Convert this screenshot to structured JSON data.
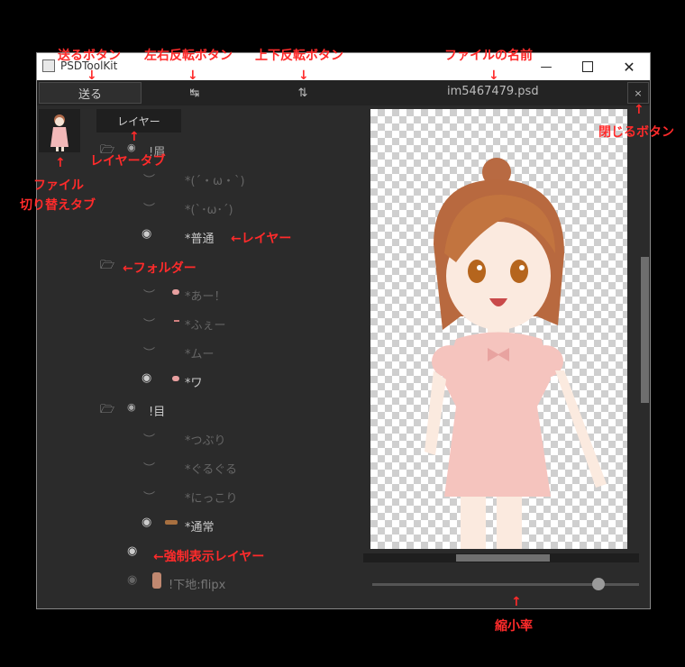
{
  "window": {
    "title": "PSDToolKit"
  },
  "toolbar": {
    "send_label": "送る",
    "flip_h_icon": "↹",
    "flip_v_icon": "⇅",
    "file_name": "im5467479.psd",
    "close_label": "×"
  },
  "panel": {
    "layer_tab": "レイヤー"
  },
  "layers": [
    {
      "name": "!眉",
      "kind": "folder"
    },
    {
      "name": "*(´・ω・`)",
      "kind": "layer"
    },
    {
      "name": "*(`･ω･´)",
      "kind": "layer"
    },
    {
      "name": "*普通",
      "kind": "layer"
    },
    {
      "name": "",
      "kind": "folder"
    },
    {
      "name": "*あー！",
      "kind": "layer"
    },
    {
      "name": "*ふぇー",
      "kind": "layer"
    },
    {
      "name": "*ムー",
      "kind": "layer"
    },
    {
      "name": "*ワ",
      "kind": "layer"
    },
    {
      "name": "!目",
      "kind": "folder"
    },
    {
      "name": "*つぶり",
      "kind": "layer"
    },
    {
      "name": "*ぐるぐる",
      "kind": "layer"
    },
    {
      "name": "*にっこり",
      "kind": "layer"
    },
    {
      "name": "*通常",
      "kind": "layer"
    },
    {
      "name": "",
      "kind": "forced"
    },
    {
      "name": "!下地:flipx",
      "kind": "forced"
    }
  ],
  "annotations": {
    "send_button": "送るボタン",
    "flip_h_button": "左右反転ボタン",
    "flip_v_button": "上下反転ボタン",
    "file_name": "ファイルの名前",
    "close_button": "閉じるボタン",
    "layer_tab": "レイヤータブ",
    "file_tab_line1": "ファイル",
    "file_tab_line2": "切り替えタブ",
    "layer": "レイヤー",
    "folder": "フォルダー",
    "forced_layer": "強制表示レイヤー",
    "zoom": "縮小率"
  },
  "colors": {
    "annotation": "#ff2b2b",
    "window_bg": "#2b2b2b",
    "titlebar": "#ffffff"
  }
}
